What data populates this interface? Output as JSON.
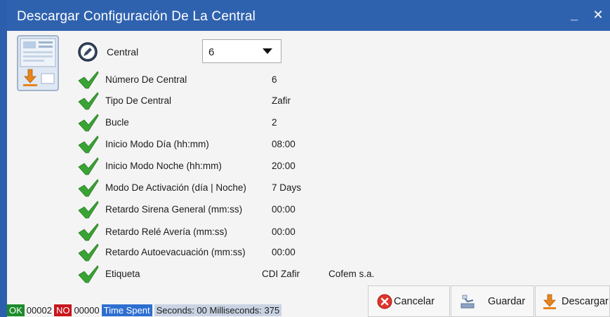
{
  "window": {
    "title": "Descargar Configuración De La Central",
    "minimize_glyph": "_",
    "close_glyph": "✕"
  },
  "central": {
    "label": "Central",
    "selected": "6"
  },
  "fields": [
    {
      "label": "Número De Central",
      "value": "6"
    },
    {
      "label": "Tipo De Central",
      "value": "Zafir"
    },
    {
      "label": "Bucle",
      "value": "2"
    },
    {
      "label": "Inicio Modo Día (hh:mm)",
      "value": "08:00"
    },
    {
      "label": "Inicio Modo Noche (hh:mm)",
      "value": "20:00"
    },
    {
      "label": "Modo De Activación (día | Noche)",
      "value": "7 Days"
    },
    {
      "label": "Retardo Sirena General (mm:ss)",
      "value": "00:00"
    },
    {
      "label": "Retardo Relé Avería (mm:ss)",
      "value": "00:00"
    },
    {
      "label": "Retardo Autoevacuación (mm:ss)",
      "value": "00:00"
    },
    {
      "label": "Etiqueta",
      "value": "CDI Zafir",
      "value2": "Cofem s.a."
    }
  ],
  "status": {
    "ok_label": "OK",
    "ok_count": "00002",
    "no_label": "NO",
    "no_count": "00000",
    "time_label": "Time Spent",
    "timing": "Seconds: 00 Milliseconds: 375"
  },
  "buttons": {
    "cancel": "Cancelar",
    "save": "Guardar",
    "download": "Descargar"
  },
  "colors": {
    "titlebar": "#2f62ae",
    "check": "#3aa335",
    "ok_badge": "#1b8c2a",
    "no_badge": "#c8161d",
    "time_badge": "#2d6fd1"
  },
  "icons": {
    "panel": "fire-panel-download-icon",
    "edit": "edit-pencil-icon",
    "check": "check-icon",
    "cancel": "cancel-icon",
    "save": "save-icon",
    "download": "download-icon"
  }
}
